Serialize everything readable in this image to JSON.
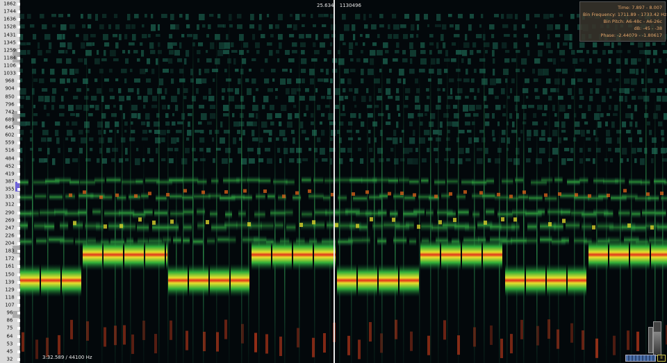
{
  "frequency_axis": {
    "labels": [
      "1862",
      "1744",
      "1636",
      "1528",
      "1431",
      "1345",
      "1259",
      "1184",
      "1106",
      "1033",
      "968",
      "904",
      "850",
      "796",
      "742",
      "689",
      "645",
      "602",
      "559",
      "516",
      "484",
      "452",
      "419",
      "387",
      "355",
      "333",
      "312",
      "290",
      "269",
      "247",
      "226",
      "204",
      "183",
      "172",
      "161",
      "150",
      "139",
      "129",
      "118",
      "107",
      "96",
      "86",
      "75",
      "64",
      "53",
      "45",
      "32"
    ]
  },
  "cursor_readout": {
    "time": "25.634",
    "sample": "1130496"
  },
  "info_panel": {
    "time": "Time: 7.897 - 8.007",
    "bin_frequency": "Bin Frequency: 1711.89 - 1733.42 Hz",
    "bin_pitch": "Bin Pitch: A6-48c - A6-26c",
    "db": "dB: -45 - -38",
    "phase": "Phase: -2.44079 - -1.80617"
  },
  "status_bar": {
    "text": "3:32.589 / 44100 Hz"
  },
  "corner_label": "II",
  "colors": {
    "background": "#03080b",
    "low_energy": "#0d3b33",
    "mid_energy": "#2fae3a",
    "high_energy": "#e7e02c",
    "peak_energy": "#e2321b",
    "info_text": "#e6a66a",
    "key_highlight": "#6e63d8"
  },
  "icons": {
    "level_meter": "level-meter-icon",
    "scroll": "timeline-scroll-icon"
  }
}
